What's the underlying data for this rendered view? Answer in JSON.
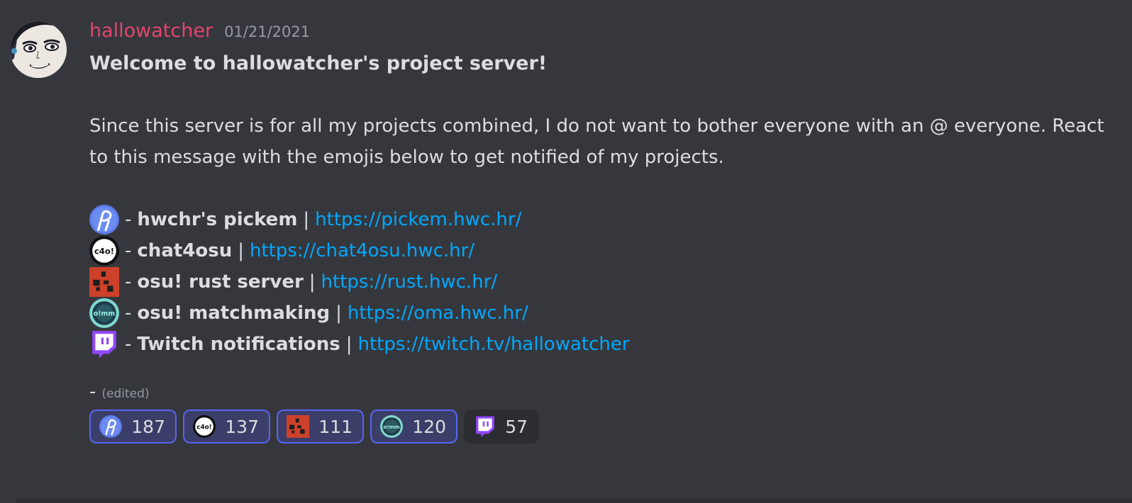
{
  "message": {
    "username": "hallowatcher",
    "timestamp": "01/21/2021",
    "title": "Welcome to hallowatcher's project server!",
    "body": "Since this server is for all my projects combined, I do not want to bother everyone with an @ everyone. React to this message with the emojis below to get notified of my projects.",
    "projects": [
      {
        "emoji": "pickem-emoji",
        "dash": "-",
        "name": "hwchr's pickem",
        "sep": "|",
        "url": "https://pickem.hwc.hr/"
      },
      {
        "emoji": "chat4osu-emoji",
        "dash": "-",
        "name": "chat4osu",
        "sep": "|",
        "url": "https://chat4osu.hwc.hr/"
      },
      {
        "emoji": "rust-emoji",
        "dash": "-",
        "name": "osu! rust server",
        "sep": "|",
        "url": "https://rust.hwc.hr/"
      },
      {
        "emoji": "oma-emoji",
        "dash": "-",
        "name": "osu! matchmaking",
        "sep": "|",
        "url": "https://oma.hwc.hr/"
      },
      {
        "emoji": "twitch-emoji",
        "dash": "-",
        "name": "Twitch notifications",
        "sep": "|",
        "url": "https://twitch.tv/hallowatcher"
      }
    ],
    "trailing": "-",
    "edited": "(edited)",
    "reactions": [
      {
        "emoji": "pickem-emoji",
        "count": "187",
        "reacted": true
      },
      {
        "emoji": "chat4osu-emoji",
        "count": "137",
        "reacted": true
      },
      {
        "emoji": "rust-emoji",
        "count": "111",
        "reacted": true
      },
      {
        "emoji": "oma-emoji",
        "count": "120",
        "reacted": true
      },
      {
        "emoji": "twitch-emoji",
        "count": "57",
        "reacted": false
      }
    ]
  },
  "colors": {
    "background": "#36373d",
    "username": "#e2456e",
    "link": "#00a8fc",
    "reacted_border": "#5865f2",
    "twitch": "#9146ff",
    "rust": "#cd412b"
  }
}
